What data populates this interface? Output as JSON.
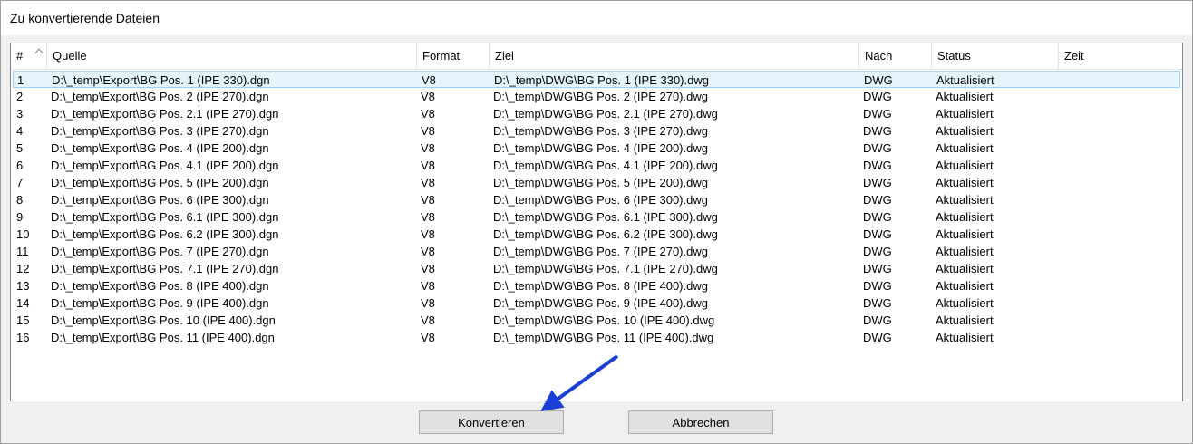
{
  "window": {
    "title": "Zu konvertierende Dateien"
  },
  "table": {
    "headers": {
      "num": "#",
      "source": "Quelle",
      "format": "Format",
      "target": "Ziel",
      "to": "Nach",
      "status": "Status",
      "time": "Zeit"
    },
    "rows": [
      {
        "num": "1",
        "source": "D:\\_temp\\Export\\BG Pos. 1 (IPE 330).dgn",
        "format": "V8",
        "target": "D:\\_temp\\DWG\\BG Pos. 1 (IPE 330).dwg",
        "to": "DWG",
        "status": "Aktualisiert",
        "time": ""
      },
      {
        "num": "2",
        "source": "D:\\_temp\\Export\\BG Pos. 2 (IPE 270).dgn",
        "format": "V8",
        "target": "D:\\_temp\\DWG\\BG Pos. 2 (IPE 270).dwg",
        "to": "DWG",
        "status": "Aktualisiert",
        "time": ""
      },
      {
        "num": "3",
        "source": "D:\\_temp\\Export\\BG Pos. 2.1 (IPE 270).dgn",
        "format": "V8",
        "target": "D:\\_temp\\DWG\\BG Pos. 2.1 (IPE 270).dwg",
        "to": "DWG",
        "status": "Aktualisiert",
        "time": ""
      },
      {
        "num": "4",
        "source": "D:\\_temp\\Export\\BG Pos. 3 (IPE 270).dgn",
        "format": "V8",
        "target": "D:\\_temp\\DWG\\BG Pos. 3 (IPE 270).dwg",
        "to": "DWG",
        "status": "Aktualisiert",
        "time": ""
      },
      {
        "num": "5",
        "source": "D:\\_temp\\Export\\BG Pos. 4 (IPE 200).dgn",
        "format": "V8",
        "target": "D:\\_temp\\DWG\\BG Pos. 4 (IPE 200).dwg",
        "to": "DWG",
        "status": "Aktualisiert",
        "time": ""
      },
      {
        "num": "6",
        "source": "D:\\_temp\\Export\\BG Pos. 4.1 (IPE 200).dgn",
        "format": "V8",
        "target": "D:\\_temp\\DWG\\BG Pos. 4.1 (IPE 200).dwg",
        "to": "DWG",
        "status": "Aktualisiert",
        "time": ""
      },
      {
        "num": "7",
        "source": "D:\\_temp\\Export\\BG Pos. 5 (IPE 200).dgn",
        "format": "V8",
        "target": "D:\\_temp\\DWG\\BG Pos. 5 (IPE 200).dwg",
        "to": "DWG",
        "status": "Aktualisiert",
        "time": ""
      },
      {
        "num": "8",
        "source": "D:\\_temp\\Export\\BG Pos. 6 (IPE 300).dgn",
        "format": "V8",
        "target": "D:\\_temp\\DWG\\BG Pos. 6 (IPE 300).dwg",
        "to": "DWG",
        "status": "Aktualisiert",
        "time": ""
      },
      {
        "num": "9",
        "source": "D:\\_temp\\Export\\BG Pos. 6.1 (IPE 300).dgn",
        "format": "V8",
        "target": "D:\\_temp\\DWG\\BG Pos. 6.1 (IPE 300).dwg",
        "to": "DWG",
        "status": "Aktualisiert",
        "time": ""
      },
      {
        "num": "10",
        "source": "D:\\_temp\\Export\\BG Pos. 6.2 (IPE 300).dgn",
        "format": "V8",
        "target": "D:\\_temp\\DWG\\BG Pos. 6.2 (IPE 300).dwg",
        "to": "DWG",
        "status": "Aktualisiert",
        "time": ""
      },
      {
        "num": "11",
        "source": "D:\\_temp\\Export\\BG Pos. 7 (IPE 270).dgn",
        "format": "V8",
        "target": "D:\\_temp\\DWG\\BG Pos. 7 (IPE 270).dwg",
        "to": "DWG",
        "status": "Aktualisiert",
        "time": ""
      },
      {
        "num": "12",
        "source": "D:\\_temp\\Export\\BG Pos. 7.1 (IPE 270).dgn",
        "format": "V8",
        "target": "D:\\_temp\\DWG\\BG Pos. 7.1 (IPE 270).dwg",
        "to": "DWG",
        "status": "Aktualisiert",
        "time": ""
      },
      {
        "num": "13",
        "source": "D:\\_temp\\Export\\BG Pos. 8 (IPE 400).dgn",
        "format": "V8",
        "target": "D:\\_temp\\DWG\\BG Pos. 8 (IPE 400).dwg",
        "to": "DWG",
        "status": "Aktualisiert",
        "time": ""
      },
      {
        "num": "14",
        "source": "D:\\_temp\\Export\\BG Pos. 9 (IPE 400).dgn",
        "format": "V8",
        "target": "D:\\_temp\\DWG\\BG Pos. 9 (IPE 400).dwg",
        "to": "DWG",
        "status": "Aktualisiert",
        "time": ""
      },
      {
        "num": "15",
        "source": "D:\\_temp\\Export\\BG Pos. 10 (IPE 400).dgn",
        "format": "V8",
        "target": "D:\\_temp\\DWG\\BG Pos. 10 (IPE 400).dwg",
        "to": "DWG",
        "status": "Aktualisiert",
        "time": ""
      },
      {
        "num": "16",
        "source": "D:\\_temp\\Export\\BG Pos. 11 (IPE 400).dgn",
        "format": "V8",
        "target": "D:\\_temp\\DWG\\BG Pos. 11 (IPE 400).dwg",
        "to": "DWG",
        "status": "Aktualisiert",
        "time": ""
      }
    ],
    "selected_row": 0,
    "sort_icon": "sort-ascending-icon"
  },
  "buttons": {
    "convert_label": "Konvertieren",
    "cancel_label": "Abbrechen"
  },
  "annotation": {
    "icon": "arrow-icon",
    "color": "#1a3fd6"
  },
  "colors": {
    "selection_fill": "#e5f3fb",
    "selection_border": "#99d1ff"
  }
}
